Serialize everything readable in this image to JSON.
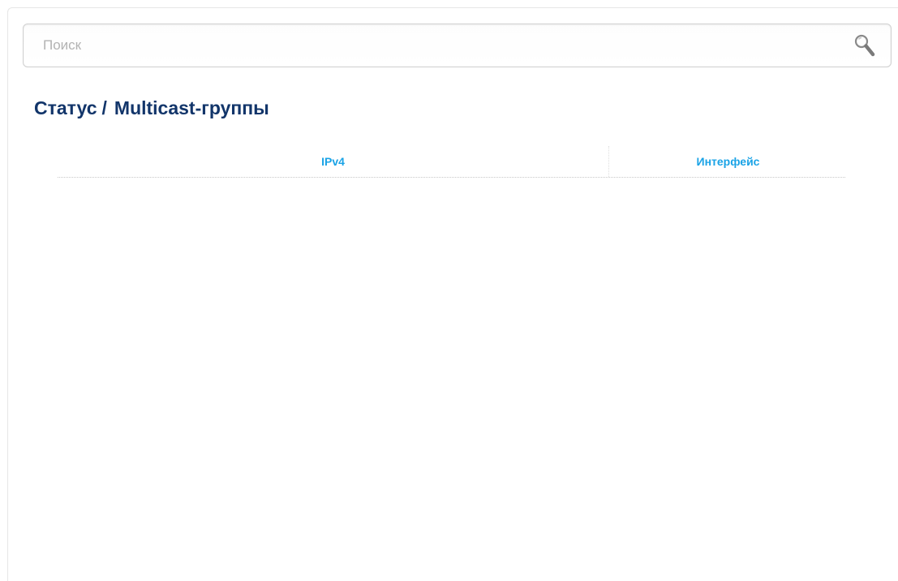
{
  "search": {
    "placeholder": "Поиск",
    "value": "",
    "icon": "magnifier-icon"
  },
  "breadcrumb": {
    "parent": "Статус",
    "separator": "/",
    "current": "Multicast-группы"
  },
  "table": {
    "columns": [
      "IPv4",
      "Интерфейс"
    ],
    "rows": []
  },
  "colors": {
    "title": "#12356a",
    "column_header": "#1aa3e6",
    "placeholder": "#b3b3b3"
  }
}
